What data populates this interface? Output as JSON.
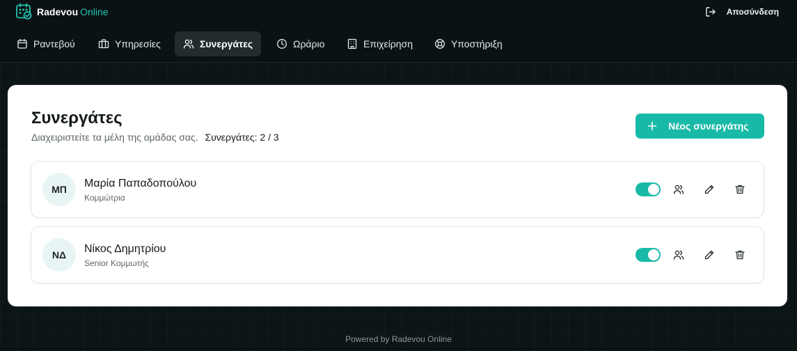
{
  "brand": {
    "name": "Radevou",
    "accent": "Online",
    "accent_color": "#22c5b4"
  },
  "header": {
    "logout_label": "Αποσύνδεση"
  },
  "nav": {
    "items": [
      {
        "label": "Ραντεβού",
        "icon": "calendar-icon",
        "active": false
      },
      {
        "label": "Υπηρεσίες",
        "icon": "briefcase-icon",
        "active": false
      },
      {
        "label": "Συνεργάτες",
        "icon": "users-icon",
        "active": true
      },
      {
        "label": "Ωράριο",
        "icon": "clock-icon",
        "active": false
      },
      {
        "label": "Επιχείρηση",
        "icon": "building-icon",
        "active": false
      },
      {
        "label": "Υποστήριξη",
        "icon": "lifebuoy-icon",
        "active": false
      }
    ]
  },
  "page": {
    "title": "Συνεργάτες",
    "subtitle": "Διαχειριστείτε τα μέλη της ομάδας σας.",
    "count_label": "Συνεργάτες: 2 / 3",
    "new_button": "Νέος συνεργάτης"
  },
  "partners": [
    {
      "initials": "ΜΠ",
      "name": "Μαρία Παπαδοπούλου",
      "role": "Κομμώτρια",
      "active": true
    },
    {
      "initials": "ΝΔ",
      "name": "Νίκος Δημητρίου",
      "role": "Senior Κομμωτής",
      "active": true
    }
  ],
  "footer": {
    "text": "Powered by Radevou Online"
  },
  "colors": {
    "primary": "#19b9a8",
    "background": "#0c1516",
    "card": "#ffffff"
  }
}
